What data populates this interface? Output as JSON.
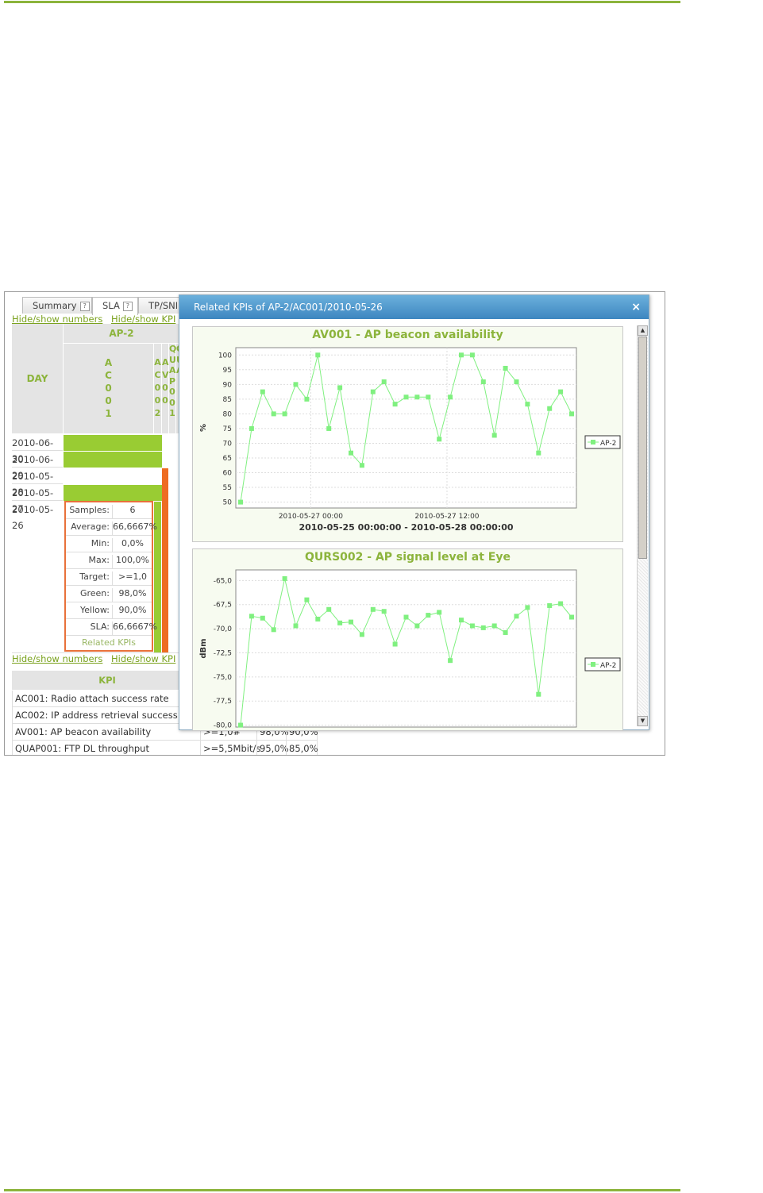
{
  "tabs": [
    {
      "label": "Summary",
      "help": "?"
    },
    {
      "label": "SLA",
      "help": "?"
    },
    {
      "label": "TP/SNI",
      "help": ""
    }
  ],
  "links": {
    "hide_show_numbers": "Hide/show numbers",
    "hide_show_kpi": "Hide/show KPI"
  },
  "grid": {
    "group_header": "AP-2",
    "day_header": "DAY",
    "col1_letters": [
      "A",
      "C",
      "0",
      "0",
      "1"
    ],
    "col2_letters": [
      "A",
      "C",
      "0",
      "0",
      "2"
    ],
    "col3_letters": [
      "A",
      "V",
      "0",
      "0"
    ],
    "col4_letters": [
      "Q",
      "U",
      "A",
      "P",
      "0",
      "0",
      "1"
    ],
    "col5_letters": [
      "Q",
      "U",
      "A"
    ],
    "days": [
      "2010-06-30",
      "2010-06-29",
      "2010-05-28",
      "2010-05-27",
      "2010-05-26"
    ],
    "colors": {
      "green": "#99cc33",
      "orange": "#ee6c22",
      "header_bg": "#e4e4e4",
      "accent": "#8cb43c"
    }
  },
  "stats": [
    {
      "label": "Samples:",
      "value": "6"
    },
    {
      "label": "Average:",
      "value": "66,6667%"
    },
    {
      "label": "Min:",
      "value": "0,0%"
    },
    {
      "label": "Max:",
      "value": "100,0%"
    },
    {
      "label": "Target:",
      "value": ">=1,0"
    },
    {
      "label": "Green:",
      "value": "98,0%"
    },
    {
      "label": "Yellow:",
      "value": "90,0%"
    },
    {
      "label": "SLA:",
      "value": "66,6667%"
    }
  ],
  "related_kpis_label": "Related KPIs",
  "kpi_table": {
    "header": "KPI",
    "rows": [
      {
        "name": "AC001: Radio attach success rate",
        "target": "",
        "green": "",
        "yellow": ""
      },
      {
        "name": "AC002: IP address retrieval success r",
        "target": ">=1,0#",
        "green": "",
        "yellow": ""
      },
      {
        "name": "AV001: AP beacon availability",
        "target": ">=1,0#",
        "green": "98,0%",
        "yellow": "90,0%"
      },
      {
        "name": "QUAP001: FTP DL throughput",
        "target": ">=5,5Mbit/s",
        "green": "95,0%",
        "yellow": "85,0%"
      }
    ]
  },
  "dialog": {
    "title": "Related KPIs of AP-2/AC001/2010-05-26",
    "close": "×"
  },
  "chart_data": [
    {
      "type": "line",
      "title": "AV001 - AP beacon availability",
      "ylabel": "%",
      "xlabel": "2010-05-25 00:00:00 - 2010-05-28 00:00:00",
      "x_ticks": [
        "2010-05-27 00:00",
        "2010-05-27 12:00"
      ],
      "y_ticks": [
        50,
        55,
        60,
        65,
        70,
        75,
        80,
        85,
        90,
        95,
        100
      ],
      "ylim": [
        48,
        102.5
      ],
      "legend": "AP-2",
      "legend_position": "right",
      "series": [
        {
          "name": "AP-2",
          "color": "#80f080",
          "values": [
            50,
            75,
            87.5,
            80,
            80,
            90,
            85,
            100,
            75,
            88.9,
            66.7,
            62.5,
            87.5,
            90.9,
            83.3,
            85.7,
            85.7,
            85.7,
            71.4,
            85.7,
            100,
            100,
            90.9,
            72.7,
            95.5,
            90.9,
            83.3,
            66.7,
            81.8,
            87.5,
            80
          ]
        }
      ]
    },
    {
      "type": "line",
      "title": "QURS002 - AP signal level at Eye",
      "ylabel": "dBm",
      "xlabel": "",
      "y_ticks": [
        -65.0,
        -67.5,
        -70.0,
        -72.5,
        -75.0,
        -77.5,
        -80.0
      ],
      "y_tick_labels": [
        "-65,0",
        "-67,5",
        "-70,0",
        "-72,5",
        "-75,0",
        "-77,5",
        "-80,0"
      ],
      "ylim": [
        -80.2,
        -63.9
      ],
      "legend": "AP-2",
      "legend_position": "right",
      "series": [
        {
          "name": "AP-2",
          "color": "#80f080",
          "values": [
            -80.0,
            -68.7,
            -68.9,
            -70.1,
            -64.8,
            -69.7,
            -67.0,
            -69.0,
            -68.0,
            -69.4,
            -69.3,
            -70.6,
            -68.0,
            -68.2,
            -71.6,
            -68.8,
            -69.7,
            -68.6,
            -68.3,
            -73.3,
            -69.1,
            -69.7,
            -69.9,
            -69.7,
            -70.4,
            -68.7,
            -67.8,
            -76.8,
            -67.6,
            -67.4,
            -68.8
          ]
        }
      ]
    }
  ]
}
